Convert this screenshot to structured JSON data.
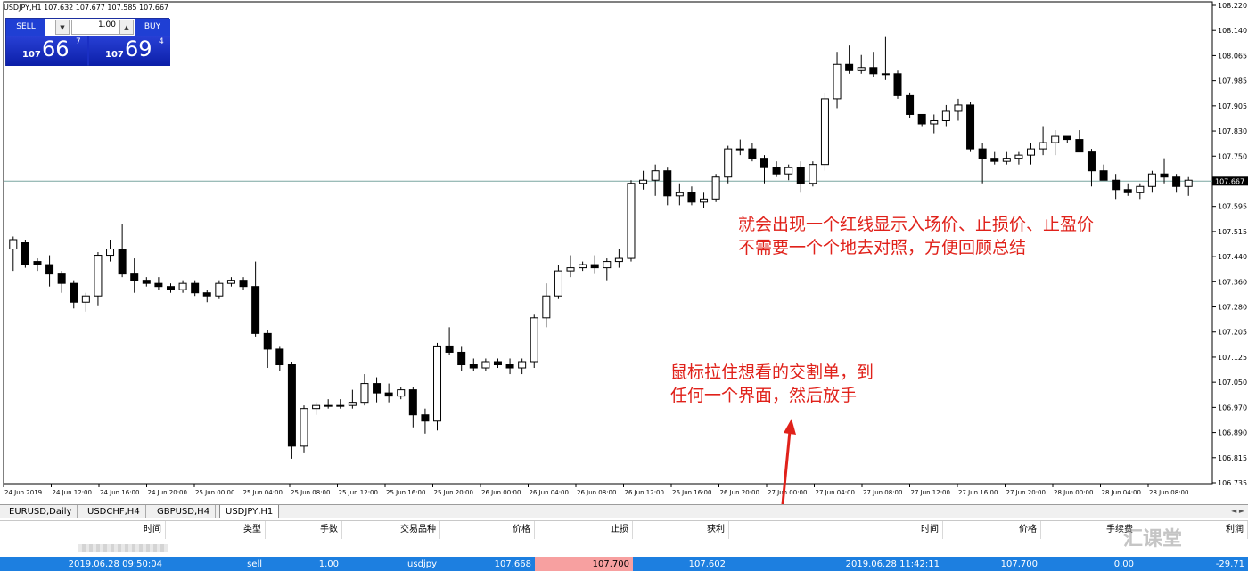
{
  "chart": {
    "symbol_title": "USDJPY,H1  107.632 107.677 107.585 107.667",
    "price_labels": [
      "108.220",
      "108.140",
      "108.065",
      "107.985",
      "107.905",
      "107.830",
      "107.750",
      "107.667",
      "107.595",
      "107.515",
      "107.440",
      "107.360",
      "107.280",
      "107.205",
      "107.125",
      "107.050",
      "106.970",
      "106.890",
      "106.815",
      "106.735"
    ],
    "current_price": "107.667",
    "time_labels": [
      "24 Jun 2019",
      "24 Jun 12:00",
      "24 Jun 16:00",
      "24 Jun 20:00",
      "25 Jun 00:00",
      "25 Jun 04:00",
      "25 Jun 08:00",
      "25 Jun 12:00",
      "25 Jun 16:00",
      "25 Jun 20:00",
      "26 Jun 00:00",
      "26 Jun 04:00",
      "26 Jun 08:00",
      "26 Jun 12:00",
      "26 Jun 16:00",
      "26 Jun 20:00",
      "27 Jun 00:00",
      "27 Jun 04:00",
      "27 Jun 08:00",
      "27 Jun 12:00",
      "27 Jun 16:00",
      "27 Jun 20:00",
      "28 Jun 00:00",
      "28 Jun 04:00",
      "28 Jun 08:00"
    ],
    "colors": {
      "up": "#ffffff",
      "down": "#000000",
      "grid": "#c0c0c0",
      "price_line": "#7aa6a0",
      "label_bg": "#000000"
    }
  },
  "chart_data": {
    "type": "candlestick",
    "ylim": [
      106.7,
      108.24
    ],
    "candles": [
      [
        107.45,
        107.49,
        107.38,
        107.48
      ],
      [
        107.47,
        107.48,
        107.39,
        107.4
      ],
      [
        107.41,
        107.42,
        107.38,
        107.4
      ],
      [
        107.4,
        107.43,
        107.33,
        107.37
      ],
      [
        107.37,
        107.38,
        107.31,
        107.34
      ],
      [
        107.34,
        107.35,
        107.26,
        107.28
      ],
      [
        107.28,
        107.31,
        107.25,
        107.3
      ],
      [
        107.3,
        107.44,
        107.27,
        107.43
      ],
      [
        107.43,
        107.48,
        107.41,
        107.45
      ],
      [
        107.45,
        107.53,
        107.36,
        107.37
      ],
      [
        107.37,
        107.42,
        107.31,
        107.35
      ],
      [
        107.35,
        107.36,
        107.33,
        107.34
      ],
      [
        107.34,
        107.36,
        107.32,
        107.33
      ],
      [
        107.33,
        107.34,
        107.31,
        107.32
      ],
      [
        107.32,
        107.35,
        107.31,
        107.34
      ],
      [
        107.34,
        107.35,
        107.3,
        107.31
      ],
      [
        107.31,
        107.32,
        107.28,
        107.3
      ],
      [
        107.3,
        107.35,
        107.29,
        107.34
      ],
      [
        107.34,
        107.36,
        107.33,
        107.35
      ],
      [
        107.35,
        107.36,
        107.32,
        107.33
      ],
      [
        107.33,
        107.41,
        107.17,
        107.18
      ],
      [
        107.18,
        107.19,
        107.07,
        107.13
      ],
      [
        107.13,
        107.14,
        107.06,
        107.08
      ],
      [
        107.08,
        107.09,
        106.78,
        106.82
      ],
      [
        106.82,
        106.95,
        106.8,
        106.94
      ],
      [
        106.94,
        106.96,
        106.92,
        106.95
      ],
      [
        106.95,
        106.97,
        106.94,
        106.95
      ],
      [
        106.95,
        106.97,
        106.94,
        106.95
      ],
      [
        106.95,
        107.0,
        106.94,
        106.96
      ],
      [
        106.96,
        107.05,
        106.95,
        107.02
      ],
      [
        107.02,
        107.04,
        106.96,
        106.99
      ],
      [
        106.99,
        107.02,
        106.96,
        106.98
      ],
      [
        106.98,
        107.01,
        106.97,
        107.0
      ],
      [
        107.0,
        107.01,
        106.88,
        106.92
      ],
      [
        106.92,
        106.94,
        106.86,
        106.9
      ],
      [
        106.9,
        107.15,
        106.87,
        107.14
      ],
      [
        107.14,
        107.2,
        107.11,
        107.12
      ],
      [
        107.12,
        107.14,
        107.06,
        107.08
      ],
      [
        107.08,
        107.1,
        107.06,
        107.07
      ],
      [
        107.07,
        107.1,
        107.06,
        107.09
      ],
      [
        107.09,
        107.1,
        107.07,
        107.08
      ],
      [
        107.08,
        107.1,
        107.05,
        107.07
      ],
      [
        107.07,
        107.1,
        107.05,
        107.09
      ],
      [
        107.09,
        107.24,
        107.07,
        107.23
      ],
      [
        107.23,
        107.34,
        107.2,
        107.3
      ],
      [
        107.3,
        107.4,
        107.29,
        107.38
      ],
      [
        107.38,
        107.43,
        107.36,
        107.39
      ],
      [
        107.39,
        107.41,
        107.38,
        107.4
      ],
      [
        107.4,
        107.43,
        107.37,
        107.39
      ],
      [
        107.39,
        107.42,
        107.35,
        107.41
      ],
      [
        107.41,
        107.45,
        107.39,
        107.42
      ],
      [
        107.42,
        107.67,
        107.41,
        107.66
      ],
      [
        107.66,
        107.7,
        107.64,
        107.67
      ],
      [
        107.67,
        107.72,
        107.62,
        107.7
      ],
      [
        107.7,
        107.71,
        107.59,
        107.62
      ],
      [
        107.62,
        107.66,
        107.59,
        107.63
      ],
      [
        107.63,
        107.65,
        107.59,
        107.6
      ],
      [
        107.6,
        107.63,
        107.58,
        107.61
      ],
      [
        107.61,
        107.69,
        107.6,
        107.68
      ],
      [
        107.68,
        107.78,
        107.66,
        107.77
      ],
      [
        107.77,
        107.8,
        107.75,
        107.77
      ],
      [
        107.77,
        107.79,
        107.73,
        107.74
      ],
      [
        107.74,
        107.75,
        107.66,
        107.71
      ],
      [
        107.71,
        107.73,
        107.68,
        107.69
      ],
      [
        107.69,
        107.72,
        107.67,
        107.71
      ],
      [
        107.71,
        107.73,
        107.63,
        107.66
      ],
      [
        107.66,
        107.73,
        107.65,
        107.72
      ],
      [
        107.72,
        107.95,
        107.7,
        107.93
      ],
      [
        107.93,
        108.08,
        107.9,
        108.04
      ],
      [
        108.04,
        108.1,
        108.01,
        108.02
      ],
      [
        108.02,
        108.07,
        108.01,
        108.03
      ],
      [
        108.03,
        108.08,
        108.0,
        108.01
      ],
      [
        108.01,
        108.13,
        107.99,
        108.01
      ],
      [
        108.01,
        108.02,
        107.93,
        107.94
      ],
      [
        107.94,
        107.95,
        107.87,
        107.88
      ],
      [
        107.88,
        107.88,
        107.84,
        107.85
      ],
      [
        107.85,
        107.88,
        107.82,
        107.86
      ],
      [
        107.86,
        107.91,
        107.84,
        107.89
      ],
      [
        107.89,
        107.93,
        107.86,
        107.91
      ],
      [
        107.91,
        107.92,
        107.76,
        107.77
      ],
      [
        107.77,
        107.79,
        107.66,
        107.74
      ],
      [
        107.74,
        107.76,
        107.72,
        107.73
      ],
      [
        107.73,
        107.76,
        107.72,
        107.74
      ],
      [
        107.74,
        107.76,
        107.72,
        107.75
      ],
      [
        107.75,
        107.79,
        107.72,
        107.77
      ],
      [
        107.77,
        107.84,
        107.75,
        107.79
      ],
      [
        107.79,
        107.83,
        107.75,
        107.81
      ],
      [
        107.81,
        107.81,
        107.79,
        107.8
      ],
      [
        107.8,
        107.83,
        107.77,
        107.76
      ],
      [
        107.76,
        107.77,
        107.65,
        107.7
      ],
      [
        107.7,
        107.72,
        107.67,
        107.67
      ],
      [
        107.67,
        107.69,
        107.61,
        107.64
      ],
      [
        107.64,
        107.66,
        107.62,
        107.63
      ],
      [
        107.63,
        107.66,
        107.61,
        107.65
      ],
      [
        107.65,
        107.7,
        107.63,
        107.69
      ],
      [
        107.69,
        107.74,
        107.66,
        107.68
      ],
      [
        107.68,
        107.69,
        107.63,
        107.65
      ],
      [
        107.65,
        107.68,
        107.62,
        107.67
      ]
    ]
  },
  "trade_panel": {
    "sell_label": "SELL",
    "buy_label": "BUY",
    "lot": "1.00",
    "dec_arrow": "▼",
    "inc_arrow": "▲",
    "sell_small": "107",
    "sell_big": "66",
    "sell_pip": "7",
    "buy_small": "107",
    "buy_big": "69",
    "buy_pip": "4"
  },
  "annotations": {
    "note1_line1": "就会出现一个红线显示入场价、止损价、止盈价",
    "note1_line2": "不需要一个个地去对照，方便回顾总结",
    "note2_line1": "鼠标拉住想看的交割单，到",
    "note2_line2": "任何一个界面，然后放手"
  },
  "tabs": [
    "EURUSD,Daily",
    "USDCHF,H4",
    "GBPUSD,H4",
    "USDJPY,H1"
  ],
  "terminal": {
    "headers": [
      "时间",
      "类型",
      "手数",
      "交易品种",
      "价格",
      "止损",
      "获利",
      "时间",
      "价格",
      "手续费",
      "利润"
    ],
    "order": {
      "open_time": "2019.06.28 09:50:04",
      "type": "sell",
      "lots": "1.00",
      "symbol": "usdjpy",
      "price": "107.668",
      "sl": "107.700",
      "tp": "107.602",
      "close_time": "2019.06.28 11:42:11",
      "close_price": "107.700",
      "commission": "0.00",
      "profit": "-29.71"
    }
  },
  "watermark": "汇课堂"
}
